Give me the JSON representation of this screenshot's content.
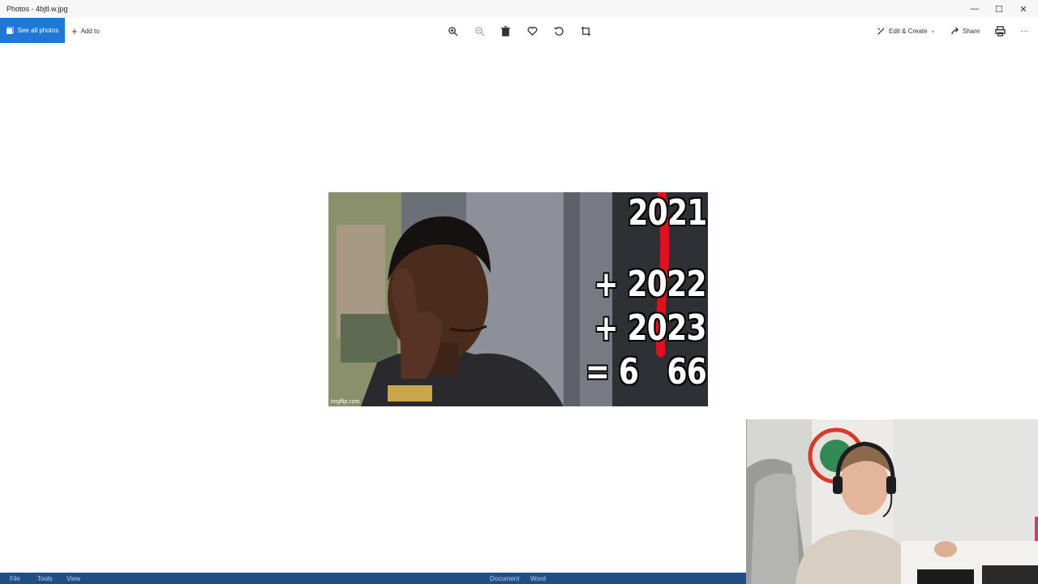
{
  "window": {
    "title": "Photos - 4bjtl.w.jpg",
    "controls": [
      "—",
      "☐",
      "✕"
    ]
  },
  "toolbar": {
    "see_all_label": "See all photos",
    "add_to_label": "Add to",
    "edit_create_label": "Edit & Create",
    "share_label": "Share",
    "more_label": "···"
  },
  "photo": {
    "numbers": {
      "line1": "2021",
      "line2": "+ 2022",
      "line3": "+ 2023",
      "line4": "= 6   66"
    },
    "watermark": "imgflip.com"
  },
  "taskbar": {
    "items": [
      "File",
      "Tools",
      "View"
    ],
    "center_items": [
      "Document",
      "Word"
    ]
  },
  "colors": {
    "accent": "#1e78d4",
    "taskbar": "#1f4f86",
    "red_mark": "#e0101e"
  }
}
